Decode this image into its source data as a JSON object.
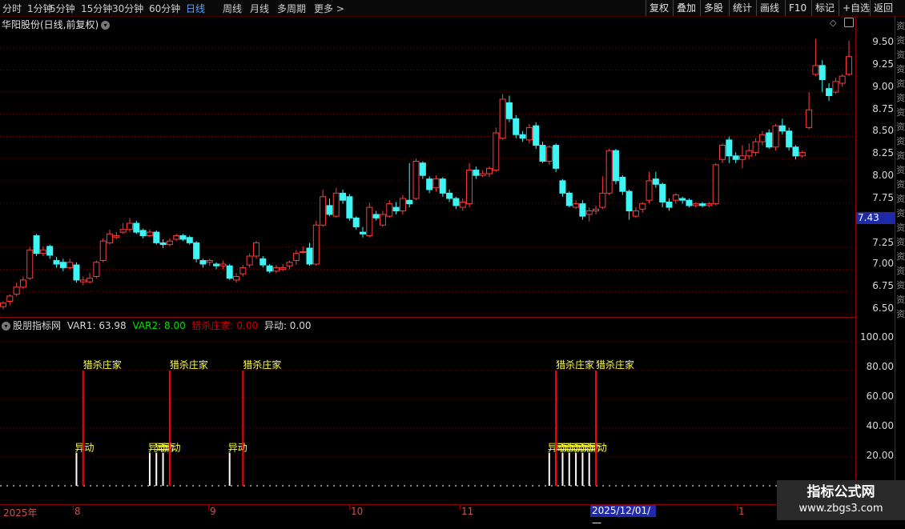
{
  "toolbar": {
    "periods": [
      "分时",
      "1分钟",
      "5分钟",
      "15分钟",
      "30分钟",
      "60分钟",
      "日线",
      "周线",
      "月线",
      "多周期",
      "更多 >"
    ],
    "active_period": "日线",
    "right_buttons": [
      "复权",
      "叠加",
      "多股",
      "统计",
      "画线",
      "F10",
      "标记",
      "+自选",
      "返回"
    ]
  },
  "main": {
    "title": "华阳股份(日线,前复权)",
    "current_price": "7.43",
    "price_ticks": [
      "9.50",
      "9.25",
      "9.00",
      "8.75",
      "8.50",
      "8.25",
      "8.00",
      "7.75",
      "7.25",
      "7.00",
      "6.75",
      "6.50"
    ]
  },
  "indicator": {
    "name": "股朋指标网",
    "var1": "VAR1: 63.98",
    "var2": "VAR2: 8.00",
    "var3": "猎杀庄家: 0.00",
    "var4": "异动: 0.00",
    "ticks": [
      "100.00",
      "80.00",
      "60.00",
      "40.00",
      "20.00"
    ],
    "signal_label_kill": "猎杀庄家",
    "signal_label_move": "异动"
  },
  "date_axis": {
    "labels": [
      "2025年",
      "8",
      "9",
      "10",
      "11",
      "1"
    ],
    "cursor_date": "2025/12/01/—"
  },
  "side_strip": [
    "资",
    "资",
    "资",
    "资",
    "资",
    "资",
    "资",
    "资",
    "资",
    "资",
    "资",
    "资",
    "资",
    "资",
    "资",
    "资",
    "资",
    "资",
    "资",
    "资",
    "资"
  ],
  "watermark": {
    "line1": "指标公式网",
    "line2": "www.zbgs3.com"
  },
  "colors": {
    "up": "#ff3b3b",
    "down": "#3ef5f5",
    "signal_red": "#ff0000",
    "label_yellow": "#ffff40",
    "var2": "#00e000",
    "var3": "#cc0000"
  },
  "chart_data": {
    "type": "candlestick",
    "ylim": [
      6.5,
      9.75
    ],
    "candles": [
      [
        6.58,
        6.62,
        6.55,
        6.64
      ],
      [
        6.64,
        6.7,
        6.6,
        6.72
      ],
      [
        6.72,
        6.8,
        6.7,
        6.85
      ],
      [
        6.8,
        6.88,
        6.78,
        6.92
      ],
      [
        6.9,
        7.22,
        6.88,
        7.25
      ],
      [
        7.38,
        7.18,
        7.15,
        7.4
      ],
      [
        7.18,
        7.22,
        7.15,
        7.26
      ],
      [
        7.26,
        7.16,
        7.12,
        7.28
      ],
      [
        7.1,
        7.06,
        7.02,
        7.14
      ],
      [
        7.08,
        7.02,
        6.98,
        7.12
      ],
      [
        7.02,
        7.08,
        7.0,
        7.12
      ],
      [
        7.05,
        6.88,
        6.85,
        7.08
      ],
      [
        6.86,
        6.88,
        6.82,
        6.92
      ],
      [
        6.86,
        6.9,
        6.84,
        6.96
      ],
      [
        6.92,
        7.08,
        6.9,
        7.1
      ],
      [
        7.1,
        7.32,
        7.08,
        7.35
      ],
      [
        7.3,
        7.4,
        7.28,
        7.45
      ],
      [
        7.36,
        7.38,
        7.34,
        7.42
      ],
      [
        7.42,
        7.45,
        7.4,
        7.52
      ],
      [
        7.45,
        7.52,
        7.42,
        7.58
      ],
      [
        7.52,
        7.42,
        7.4,
        7.55
      ],
      [
        7.44,
        7.38,
        7.35,
        7.46
      ],
      [
        7.38,
        7.42,
        7.36,
        7.45
      ],
      [
        7.42,
        7.3,
        7.28,
        7.44
      ],
      [
        7.3,
        7.28,
        7.24,
        7.34
      ],
      [
        7.28,
        7.32,
        7.26,
        7.35
      ],
      [
        7.34,
        7.38,
        7.32,
        7.4
      ],
      [
        7.38,
        7.34,
        7.32,
        7.4
      ],
      [
        7.36,
        7.3,
        7.28,
        7.38
      ],
      [
        7.3,
        7.12,
        7.08,
        7.32
      ],
      [
        7.1,
        7.06,
        7.02,
        7.12
      ],
      [
        7.08,
        7.1,
        7.04,
        7.12
      ],
      [
        7.06,
        7.04,
        7.0,
        7.08
      ],
      [
        7.04,
        7.06,
        7.0,
        7.1
      ],
      [
        7.04,
        6.9,
        6.88,
        7.06
      ],
      [
        6.88,
        6.92,
        6.85,
        6.96
      ],
      [
        6.95,
        7.02,
        6.92,
        7.05
      ],
      [
        7.05,
        7.15,
        7.02,
        7.18
      ],
      [
        7.15,
        7.3,
        7.12,
        7.32
      ],
      [
        7.12,
        7.05,
        7.02,
        7.15
      ],
      [
        7.04,
        6.98,
        6.96,
        7.06
      ],
      [
        6.98,
        7.02,
        6.96,
        7.05
      ],
      [
        7.0,
        7.02,
        6.98,
        7.06
      ],
      [
        7.04,
        7.08,
        7.0,
        7.1
      ],
      [
        7.1,
        7.18,
        7.05,
        7.22
      ],
      [
        7.2,
        7.2,
        7.18,
        7.26
      ],
      [
        7.24,
        7.06,
        7.04,
        7.3
      ],
      [
        7.06,
        7.5,
        7.04,
        7.55
      ],
      [
        7.5,
        7.82,
        7.48,
        7.9
      ],
      [
        7.72,
        7.62,
        7.6,
        7.8
      ],
      [
        7.6,
        7.86,
        7.58,
        7.92
      ],
      [
        7.86,
        7.78,
        7.74,
        7.9
      ],
      [
        7.82,
        7.58,
        7.55,
        7.85
      ],
      [
        7.58,
        7.48,
        7.45,
        7.6
      ],
      [
        7.42,
        7.4,
        7.36,
        7.48
      ],
      [
        7.38,
        7.7,
        7.36,
        7.75
      ],
      [
        7.62,
        7.58,
        7.55,
        7.66
      ],
      [
        7.5,
        7.62,
        7.48,
        7.66
      ],
      [
        7.6,
        7.74,
        7.58,
        7.78
      ],
      [
        7.7,
        7.66,
        7.62,
        7.76
      ],
      [
        7.66,
        7.8,
        7.62,
        7.84
      ],
      [
        7.78,
        7.74,
        7.7,
        8.2
      ],
      [
        7.8,
        8.22,
        7.78,
        8.25
      ],
      [
        8.2,
        8.06,
        8.02,
        8.22
      ],
      [
        8.02,
        7.9,
        7.86,
        8.05
      ],
      [
        7.92,
        8.02,
        7.88,
        8.06
      ],
      [
        8.02,
        7.86,
        7.82,
        8.04
      ],
      [
        7.86,
        7.8,
        7.76,
        7.9
      ],
      [
        7.8,
        7.72,
        7.68,
        7.82
      ],
      [
        7.7,
        7.76,
        7.66,
        7.8
      ],
      [
        7.74,
        8.12,
        7.7,
        8.2
      ],
      [
        8.12,
        8.06,
        8.02,
        8.16
      ],
      [
        8.06,
        8.08,
        8.04,
        8.12
      ],
      [
        8.08,
        8.14,
        8.04,
        8.16
      ],
      [
        8.12,
        8.54,
        8.1,
        8.6
      ],
      [
        8.48,
        8.92,
        8.46,
        8.98
      ],
      [
        8.88,
        8.7,
        8.66,
        8.96
      ],
      [
        8.7,
        8.52,
        8.48,
        8.74
      ],
      [
        8.52,
        8.48,
        8.44,
        8.56
      ],
      [
        8.46,
        8.6,
        8.42,
        8.64
      ],
      [
        8.62,
        8.4,
        8.36,
        8.66
      ],
      [
        8.4,
        8.22,
        8.2,
        8.44
      ],
      [
        8.22,
        8.38,
        8.18,
        8.4
      ],
      [
        8.4,
        8.14,
        8.1,
        8.42
      ],
      [
        8.0,
        7.86,
        7.82,
        8.02
      ],
      [
        7.86,
        7.72,
        7.7,
        7.88
      ],
      [
        7.7,
        7.74,
        7.68,
        7.78
      ],
      [
        7.74,
        7.6,
        7.56,
        7.78
      ],
      [
        7.62,
        7.66,
        7.54,
        7.7
      ],
      [
        7.66,
        7.68,
        7.62,
        7.72
      ],
      [
        7.7,
        7.86,
        7.68,
        8.05
      ],
      [
        7.86,
        8.34,
        7.84,
        8.36
      ],
      [
        8.34,
        8.0,
        7.96,
        8.36
      ],
      [
        8.04,
        7.88,
        7.84,
        8.06
      ],
      [
        7.88,
        7.66,
        7.56,
        7.9
      ],
      [
        7.6,
        7.66,
        7.58,
        7.7
      ],
      [
        7.68,
        7.74,
        7.64,
        7.76
      ],
      [
        7.78,
        8.0,
        7.74,
        8.1
      ],
      [
        8.02,
        7.96,
        7.92,
        8.1
      ],
      [
        7.96,
        7.76,
        7.7,
        7.98
      ],
      [
        7.76,
        7.7,
        7.66,
        7.8
      ],
      [
        7.78,
        7.84,
        7.74,
        7.86
      ],
      [
        7.8,
        7.78,
        7.74,
        7.82
      ],
      [
        7.78,
        7.72,
        7.7,
        7.8
      ],
      [
        7.72,
        7.74,
        7.7,
        7.76
      ],
      [
        7.74,
        7.72,
        7.7,
        7.76
      ],
      [
        7.72,
        7.74,
        7.7,
        7.76
      ],
      [
        7.74,
        8.18,
        7.72,
        8.2
      ],
      [
        8.24,
        8.4,
        8.2,
        8.42
      ],
      [
        8.46,
        8.28,
        8.2,
        8.5
      ],
      [
        8.28,
        8.24,
        8.2,
        8.32
      ],
      [
        8.24,
        8.28,
        8.14,
        8.4
      ],
      [
        8.28,
        8.34,
        8.24,
        8.42
      ],
      [
        8.32,
        8.44,
        8.28,
        8.48
      ],
      [
        8.44,
        8.52,
        8.4,
        8.56
      ],
      [
        8.54,
        8.38,
        8.36,
        8.58
      ],
      [
        8.38,
        8.62,
        8.34,
        8.64
      ],
      [
        8.62,
        8.56,
        8.52,
        8.7
      ],
      [
        8.56,
        8.38,
        8.34,
        8.6
      ],
      [
        8.38,
        8.28,
        8.24,
        8.4
      ],
      [
        8.28,
        8.32,
        8.26,
        8.34
      ],
      [
        8.6,
        8.8,
        8.58,
        9.0
      ],
      [
        9.2,
        9.3,
        9.18,
        9.6
      ],
      [
        9.3,
        9.14,
        9.0,
        9.36
      ],
      [
        9.04,
        8.96,
        8.9,
        9.1
      ],
      [
        9.0,
        9.12,
        8.98,
        9.16
      ],
      [
        9.1,
        9.18,
        9.06,
        9.2
      ],
      [
        9.2,
        9.4,
        9.18,
        9.58
      ]
    ],
    "indicator_ylim": [
      0,
      110
    ],
    "kill_signals": [
      12,
      25,
      36,
      83,
      89
    ],
    "move_bars": [
      11,
      22,
      23,
      24,
      34,
      82,
      83,
      84,
      85,
      86,
      87,
      88
    ]
  }
}
